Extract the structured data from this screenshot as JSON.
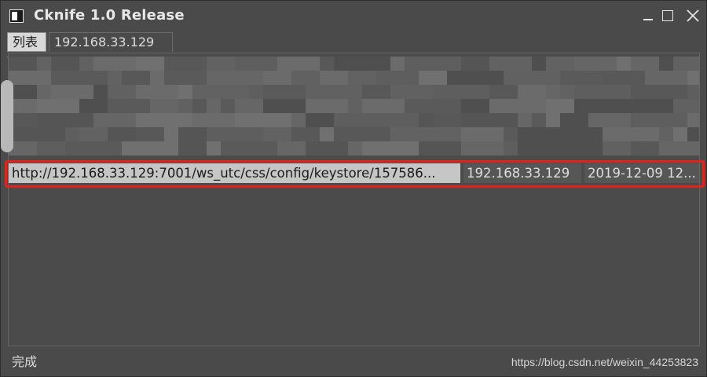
{
  "window": {
    "title": "Cknife 1.0 Release",
    "icon": "app-window-icon",
    "controls": [
      "minimize-icon",
      "maximize-icon",
      "close-icon"
    ]
  },
  "tabs": [
    {
      "label": "列表",
      "selected": true
    },
    {
      "label": "192.168.33.129",
      "selected": false
    }
  ],
  "result_row": {
    "url": "http://192.168.33.129:7001/ws_utc/css/config/keystore/157586...",
    "host": "192.168.33.129",
    "time": "2019-12-09 12..."
  },
  "status": {
    "text": "完成"
  },
  "watermark": "https://blog.csdn.net/weixin_44253823",
  "colors": {
    "highlight": "#e0241b",
    "selected_row": "#c6c6c6",
    "background": "#4a4a4a"
  }
}
